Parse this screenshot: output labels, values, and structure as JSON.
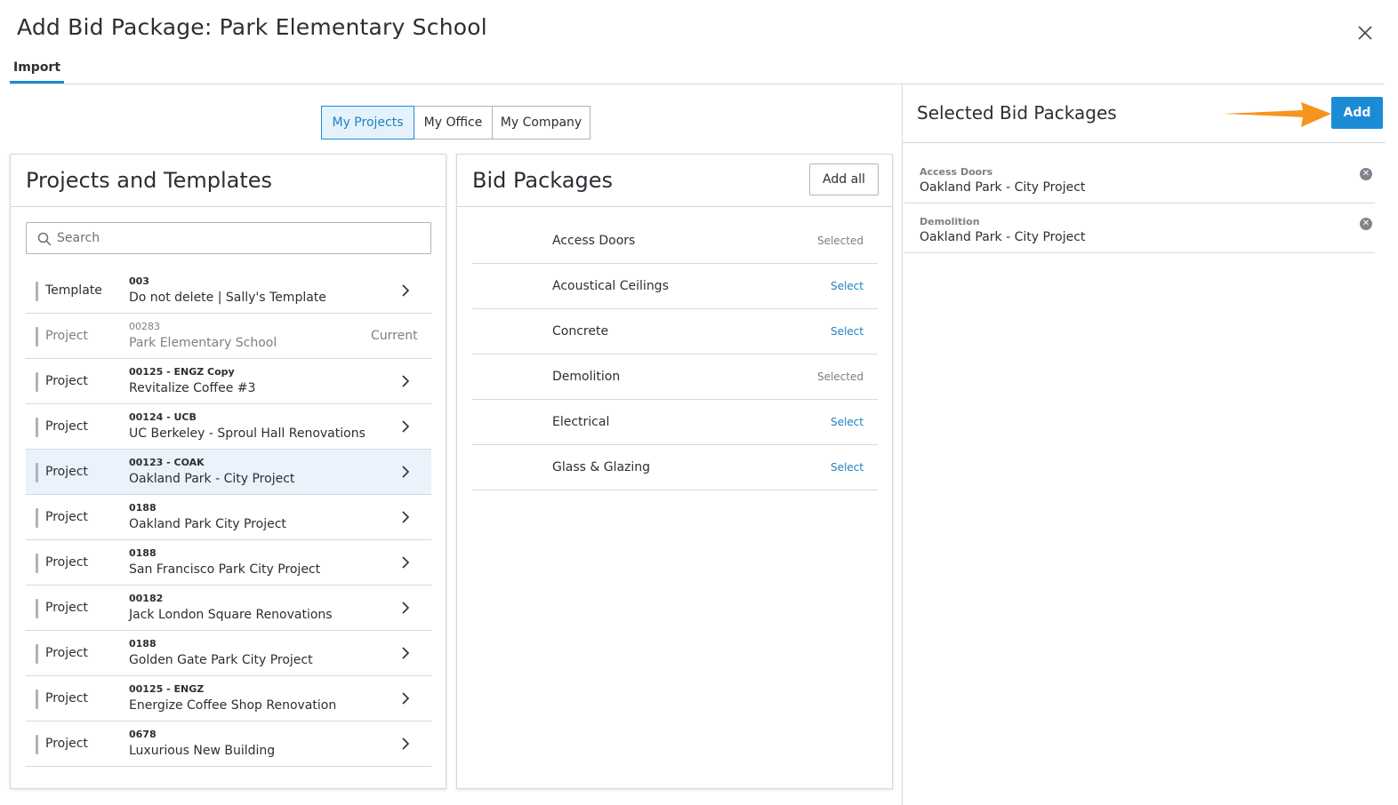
{
  "dialog": {
    "title": "Add Bid Package: Park Elementary School",
    "tabs": [
      {
        "label": "Import",
        "active": true
      }
    ]
  },
  "scope_toggle": {
    "options": [
      {
        "label": "My Projects",
        "active": true
      },
      {
        "label": "My Office",
        "active": false
      },
      {
        "label": "My Company",
        "active": false
      }
    ]
  },
  "projects_panel": {
    "title": "Projects and Templates",
    "search_placeholder": "Search",
    "rows": [
      {
        "type": "Template",
        "number": "003",
        "name": "Do not delete | Sally's Template",
        "status": "",
        "disabled": false,
        "highlight": false
      },
      {
        "type": "Project",
        "number": "00283",
        "name": "Park Elementary School",
        "status": "Current",
        "disabled": true,
        "highlight": false
      },
      {
        "type": "Project",
        "number": "00125 - ENGZ Copy",
        "name": "Revitalize Coffee #3",
        "status": "",
        "disabled": false,
        "highlight": false
      },
      {
        "type": "Project",
        "number": "00124 - UCB",
        "name": "UC Berkeley - Sproul Hall Renovations",
        "status": "",
        "disabled": false,
        "highlight": false
      },
      {
        "type": "Project",
        "number": "00123 - COAK",
        "name": "Oakland Park - City Project",
        "status": "",
        "disabled": false,
        "highlight": true
      },
      {
        "type": "Project",
        "number": "0188",
        "name": "Oakland Park City Project",
        "status": "",
        "disabled": false,
        "highlight": false
      },
      {
        "type": "Project",
        "number": "0188",
        "name": "San Francisco Park City Project",
        "status": "",
        "disabled": false,
        "highlight": false
      },
      {
        "type": "Project",
        "number": "00182",
        "name": "Jack London Square Renovations",
        "status": "",
        "disabled": false,
        "highlight": false
      },
      {
        "type": "Project",
        "number": "0188",
        "name": "Golden Gate Park City Project",
        "status": "",
        "disabled": false,
        "highlight": false
      },
      {
        "type": "Project",
        "number": "00125 - ENGZ",
        "name": "Energize Coffee Shop Renovation",
        "status": "",
        "disabled": false,
        "highlight": false
      },
      {
        "type": "Project",
        "number": "0678",
        "name": "Luxurious New Building",
        "status": "",
        "disabled": false,
        "highlight": false
      }
    ]
  },
  "bid_packages_panel": {
    "title": "Bid Packages",
    "add_all_label": "Add all",
    "rows": [
      {
        "name": "Access Doors",
        "action": "Selected",
        "selected": true
      },
      {
        "name": "Acoustical Ceilings",
        "action": "Select",
        "selected": false
      },
      {
        "name": "Concrete",
        "action": "Select",
        "selected": false
      },
      {
        "name": "Demolition",
        "action": "Selected",
        "selected": true
      },
      {
        "name": "Electrical",
        "action": "Select",
        "selected": false
      },
      {
        "name": "Glass & Glazing",
        "action": "Select",
        "selected": false
      }
    ]
  },
  "selected_panel": {
    "title": "Selected Bid Packages",
    "add_label": "Add",
    "items": [
      {
        "category": "Access Doors",
        "project": "Oakland Park - City Project"
      },
      {
        "category": "Demolition",
        "project": "Oakland Park - City Project"
      }
    ]
  },
  "colors": {
    "accent": "#1c8bd6",
    "annotation_arrow": "#f7941d",
    "highlight_row": "#eaf3fb"
  },
  "icons": {
    "close": "close-icon",
    "search": "search-icon",
    "chevron": "chevron-right-icon",
    "remove": "remove-circle-icon",
    "arrow": "annotation-arrow-icon"
  }
}
